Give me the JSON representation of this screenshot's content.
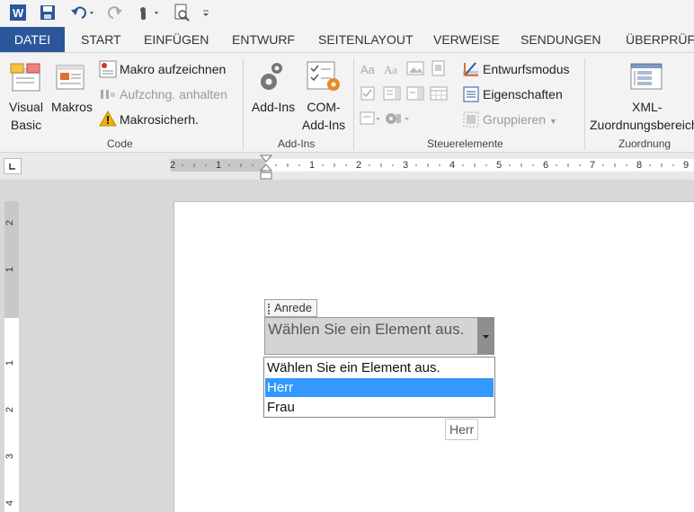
{
  "qat": {
    "app_icon": "word-icon",
    "icons": [
      "save-icon",
      "undo-icon",
      "redo-icon",
      "touch-mode-icon",
      "print-preview-icon",
      "customize-icon"
    ]
  },
  "tabs": [
    "DATEI",
    "START",
    "EINFÜGEN",
    "ENTWURF",
    "SEITENLAYOUT",
    "VERWEISE",
    "SENDUNGEN",
    "ÜBERPRÜFE"
  ],
  "ribbon": {
    "code": {
      "label": "Code",
      "visual_basic": [
        "Visual",
        "Basic"
      ],
      "makros": "Makros",
      "makro_aufzeichnen": "Makro aufzeichnen",
      "aufzeichnung_anhalten": "Aufzchng. anhalten",
      "makrosicherheit": "Makrosicherh."
    },
    "addins": {
      "label": "Add-Ins",
      "addins": "Add-Ins",
      "com_addins": [
        "COM-",
        "Add-Ins"
      ]
    },
    "controls": {
      "label": "Steuerelemente",
      "entwurfsmodus": "Entwurfsmodus",
      "eigenschaften": "Eigenschaften",
      "gruppieren": "Gruppieren"
    },
    "mapping": {
      "label": "Zuordnung",
      "xml": [
        "XML-",
        "Zuordnungsbereich"
      ]
    }
  },
  "ruler": {
    "h_ticks": [
      "2",
      "1",
      "1",
      "2",
      "3",
      "4",
      "5",
      "6",
      "7",
      "8",
      "9"
    ],
    "v_ticks": [
      "2",
      "1",
      "1",
      "2",
      "3",
      "4"
    ]
  },
  "content_control": {
    "title": "Anrede",
    "placeholder": "Wählen Sie ein Element aus.",
    "items": [
      "Wählen Sie ein Element aus.",
      "Herr",
      "Frau"
    ],
    "selected_index": 1,
    "tooltip": "Herr"
  },
  "colors": {
    "accent": "#2b579a",
    "selection": "#3399ff"
  }
}
